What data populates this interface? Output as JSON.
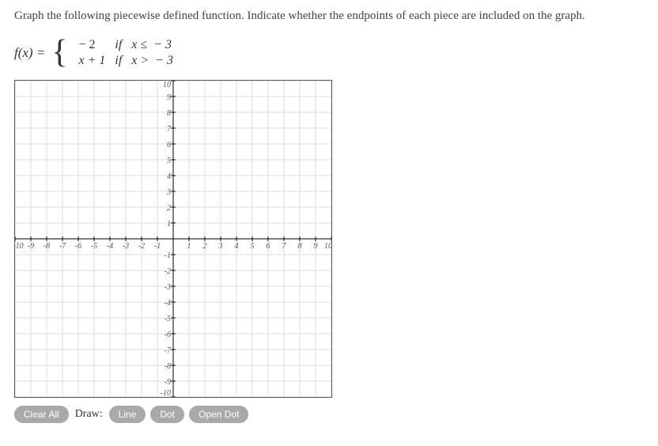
{
  "prompt": "Graph the following piecewise defined function. Indicate whether the endpoints of each piece are included on the graph.",
  "equation": {
    "lhs": "f(x) =",
    "row1_expr": "− 2",
    "row1_cond": "if   x ≤  − 3",
    "row2_expr": "x + 1",
    "row2_cond": "if   x >  − 3"
  },
  "graph": {
    "xmin": -10,
    "xmax": 10,
    "ymin": -10,
    "ymax": 10,
    "xticks": [
      "-10",
      "-9",
      "-8",
      "-7",
      "-6",
      "-5",
      "-4",
      "-3",
      "-2",
      "-1",
      "1",
      "2",
      "3",
      "4",
      "5",
      "6",
      "7",
      "8",
      "9",
      "10"
    ],
    "yticks": [
      "10",
      "9",
      "8",
      "7",
      "6",
      "5",
      "4",
      "3",
      "2",
      "1",
      "-1",
      "-2",
      "-3",
      "-4",
      "-5",
      "-6",
      "-7",
      "-8",
      "-9",
      "-10"
    ]
  },
  "toolbar": {
    "clear": "Clear All",
    "drawlabel": "Draw:",
    "line": "Line",
    "dot": "Dot",
    "opendot": "Open Dot"
  }
}
